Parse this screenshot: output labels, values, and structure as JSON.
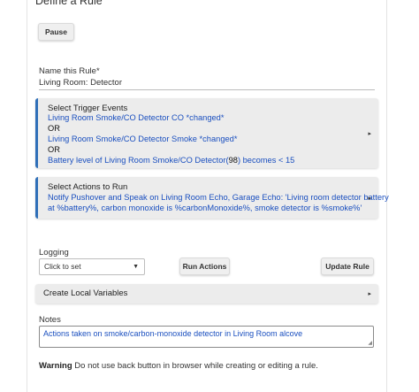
{
  "page": {
    "title": "Define a Rule"
  },
  "toolbar": {
    "pause_label": "Pause"
  },
  "name_field": {
    "label": "Name this Rule*",
    "value": "Living Room: Detector"
  },
  "triggers": {
    "title": "Select Trigger Events",
    "lines": [
      "Living Room Smoke/CO Detector CO *changed*",
      "OR",
      "Living Room Smoke/CO Detector Smoke *changed*",
      "OR"
    ],
    "battery_prefix": "Battery level of Living Room Smoke/CO Detector(",
    "battery_value": "98",
    "battery_suffix": ") becomes < 15",
    "arrow": "▸"
  },
  "actions": {
    "title": "Select Actions to Run",
    "lines": [
      "Notify Pushover and Speak on Living Room Echo, Garage Echo: 'Living room detector battery",
      "at %battery%, carbon monoxide is %carbonMonoxide%, smoke detector is %smoke%'"
    ],
    "arrow": "▸"
  },
  "logging": {
    "label": "Logging",
    "placeholder": "Click to set",
    "icon": "chevron-down-icon"
  },
  "buttons": {
    "run_actions": "Run Actions",
    "update_rule": "Update Rule"
  },
  "local_vars": {
    "title": "Create Local Variables",
    "arrow": "▸"
  },
  "notes": {
    "label": "Notes",
    "value": "Actions taken on smoke/carbon-monoxide detector in Living Room alcove"
  },
  "warning": {
    "bold": "Warning",
    "text": " Do not use back button in browser while creating or editing a rule."
  },
  "colors": {
    "accent": "#2f6fb8",
    "link": "#1a4fbf",
    "section_bg": "#ececec"
  }
}
